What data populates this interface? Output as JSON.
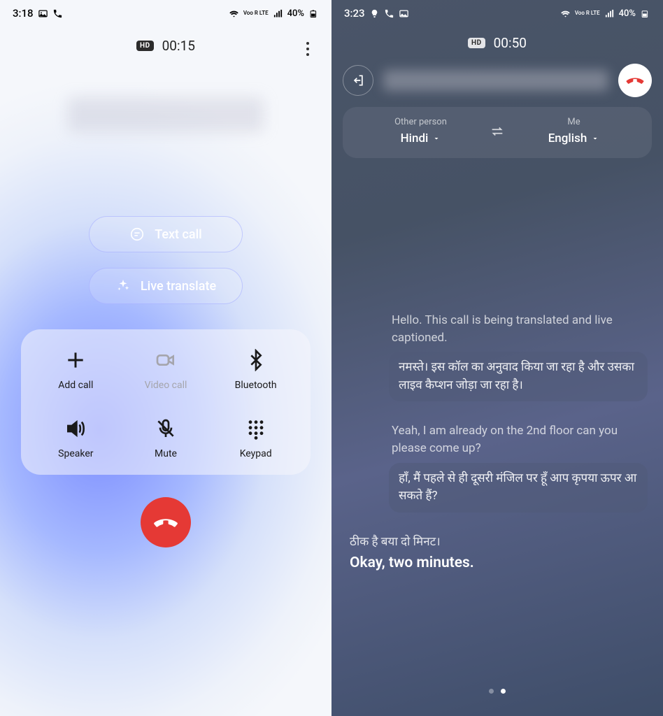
{
  "left": {
    "status": {
      "time": "3:18",
      "battery": "40%",
      "lte": "Voo R LTE"
    },
    "hd": "HD",
    "timer": "00:15",
    "text_call": "Text call",
    "live_translate": "Live translate",
    "tray": {
      "add_call": "Add call",
      "video_call": "Video call",
      "bluetooth": "Bluetooth",
      "speaker": "Speaker",
      "mute": "Mute",
      "keypad": "Keypad"
    }
  },
  "right": {
    "status": {
      "time": "3:23",
      "battery": "40%",
      "lte": "Voo R LTE"
    },
    "hd": "HD",
    "timer": "00:50",
    "lang": {
      "other_label": "Other person",
      "other_value": "Hindi",
      "me_label": "Me",
      "me_value": "English"
    },
    "msg1": {
      "en": "Hello. This call is being translated and live captioned.",
      "hi": "नमस्ते। इस कॉल का अनुवाद किया जा रहा है और उसका लाइव कैप्शन जोड़ा जा रहा है।"
    },
    "msg2": {
      "en": "Yeah, I am already on the 2nd floor can you please come up?",
      "hi": "हाँ, मैं पहले से ही दूसरी मंजिल पर हूँ आप कृपया ऊपर आ सकते हैं?"
    },
    "msg3": {
      "hi": "ठीक है बया दो मिनट।",
      "en": "Okay, two minutes."
    }
  }
}
